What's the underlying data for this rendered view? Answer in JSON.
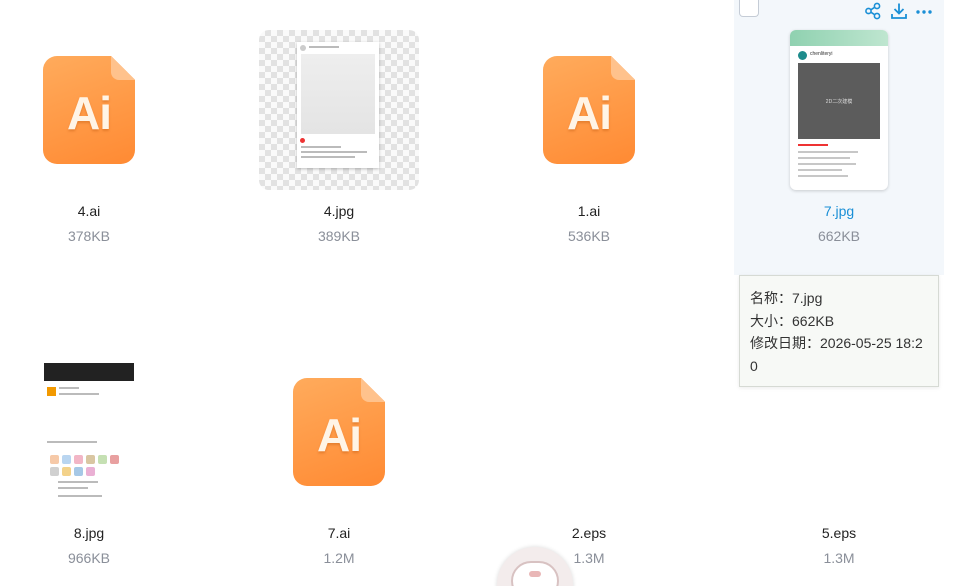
{
  "files": [
    {
      "name": "4.ai",
      "size": "378KB",
      "thumb": "ai",
      "label": "Ai"
    },
    {
      "name": "4.jpg",
      "size": "389KB",
      "thumb": "post"
    },
    {
      "name": "1.ai",
      "size": "536KB",
      "thumb": "ai",
      "label": "Ai"
    },
    {
      "name": "7.jpg",
      "size": "662KB",
      "thumb": "phone",
      "phone_caption": "2D二次建模",
      "phone_user": "chenliteryi",
      "selected": true
    },
    {
      "name": "8.jpg",
      "size": "966KB",
      "thumb": "chat",
      "chat_title": "朋友圈"
    },
    {
      "name": "7.ai",
      "size": "1.2M",
      "thumb": "ai",
      "label": "Ai"
    },
    {
      "name": "2.eps",
      "size": "1.3M",
      "thumb": "none"
    },
    {
      "name": "5.eps",
      "size": "1.3M",
      "thumb": "none"
    }
  ],
  "tooltip": {
    "name_line": "名称：7.jpg",
    "size_line": "大小：662KB",
    "date_line": "修改日期：2026-05-25 18:20"
  },
  "actions": {
    "share_icon": "share-icon",
    "download_icon": "download-icon",
    "more_icon": "more-icon"
  },
  "colors": {
    "accent": "#1a8fd6",
    "ai_orange": "#ff8a33",
    "selected_bg": "#f3f7fb"
  }
}
